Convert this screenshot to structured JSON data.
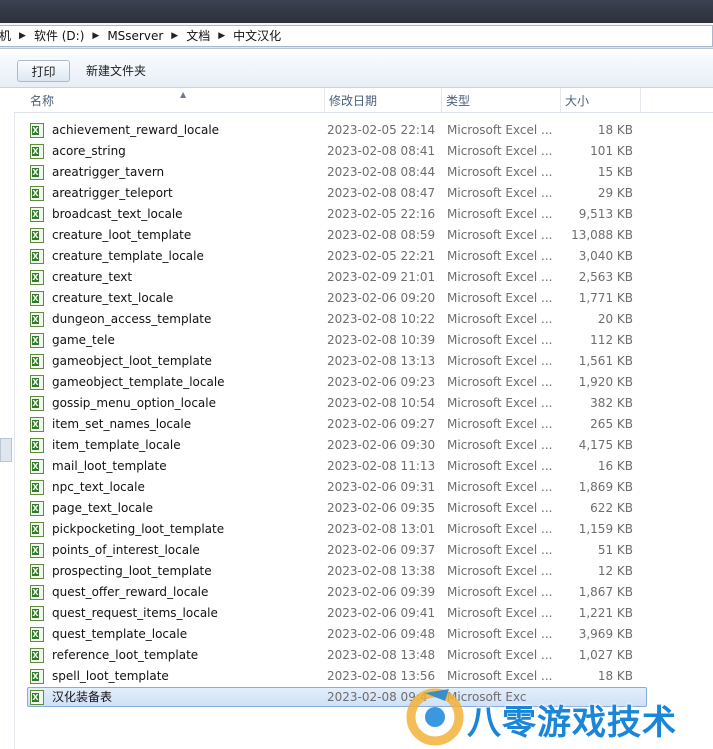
{
  "address": {
    "segments": [
      "机",
      "软件 (D:)",
      "MSserver",
      "文档",
      "中文汉化"
    ]
  },
  "toolbar": {
    "print_label": "打印",
    "new_folder_label": "新建文件夹"
  },
  "columns": {
    "name": "名称",
    "date": "修改日期",
    "type": "类型",
    "size": "大小"
  },
  "files": [
    {
      "name": "achievement_reward_locale",
      "date": "2023-02-05 22:14",
      "type": "Microsoft Excel ...",
      "size": "18 KB"
    },
    {
      "name": "acore_string",
      "date": "2023-02-08 08:41",
      "type": "Microsoft Excel ...",
      "size": "101 KB"
    },
    {
      "name": "areatrigger_tavern",
      "date": "2023-02-08 08:44",
      "type": "Microsoft Excel ...",
      "size": "15 KB"
    },
    {
      "name": "areatrigger_teleport",
      "date": "2023-02-08 08:47",
      "type": "Microsoft Excel ...",
      "size": "29 KB"
    },
    {
      "name": "broadcast_text_locale",
      "date": "2023-02-05 22:16",
      "type": "Microsoft Excel ...",
      "size": "9,513 KB"
    },
    {
      "name": "creature_loot_template",
      "date": "2023-02-08 08:59",
      "type": "Microsoft Excel ...",
      "size": "13,088 KB"
    },
    {
      "name": "creature_template_locale",
      "date": "2023-02-05 22:21",
      "type": "Microsoft Excel ...",
      "size": "3,040 KB"
    },
    {
      "name": "creature_text",
      "date": "2023-02-09 21:01",
      "type": "Microsoft Excel ...",
      "size": "2,563 KB"
    },
    {
      "name": "creature_text_locale",
      "date": "2023-02-06 09:20",
      "type": "Microsoft Excel ...",
      "size": "1,771 KB"
    },
    {
      "name": "dungeon_access_template",
      "date": "2023-02-08 10:22",
      "type": "Microsoft Excel ...",
      "size": "20 KB"
    },
    {
      "name": "game_tele",
      "date": "2023-02-08 10:39",
      "type": "Microsoft Excel ...",
      "size": "112 KB"
    },
    {
      "name": "gameobject_loot_template",
      "date": "2023-02-08 13:13",
      "type": "Microsoft Excel ...",
      "size": "1,561 KB"
    },
    {
      "name": "gameobject_template_locale",
      "date": "2023-02-06 09:23",
      "type": "Microsoft Excel ...",
      "size": "1,920 KB"
    },
    {
      "name": "gossip_menu_option_locale",
      "date": "2023-02-08 10:54",
      "type": "Microsoft Excel ...",
      "size": "382 KB"
    },
    {
      "name": "item_set_names_locale",
      "date": "2023-02-06 09:27",
      "type": "Microsoft Excel ...",
      "size": "265 KB"
    },
    {
      "name": "item_template_locale",
      "date": "2023-02-06 09:30",
      "type": "Microsoft Excel ...",
      "size": "4,175 KB"
    },
    {
      "name": "mail_loot_template",
      "date": "2023-02-08 11:13",
      "type": "Microsoft Excel ...",
      "size": "16 KB"
    },
    {
      "name": "npc_text_locale",
      "date": "2023-02-06 09:31",
      "type": "Microsoft Excel ...",
      "size": "1,869 KB"
    },
    {
      "name": "page_text_locale",
      "date": "2023-02-06 09:35",
      "type": "Microsoft Excel ...",
      "size": "622 KB"
    },
    {
      "name": "pickpocketing_loot_template",
      "date": "2023-02-08 13:01",
      "type": "Microsoft Excel ...",
      "size": "1,159 KB"
    },
    {
      "name": "points_of_interest_locale",
      "date": "2023-02-06 09:37",
      "type": "Microsoft Excel ...",
      "size": "51 KB"
    },
    {
      "name": "prospecting_loot_template",
      "date": "2023-02-08 13:38",
      "type": "Microsoft Excel ...",
      "size": "12 KB"
    },
    {
      "name": "quest_offer_reward_locale",
      "date": "2023-02-06 09:39",
      "type": "Microsoft Excel ...",
      "size": "1,867 KB"
    },
    {
      "name": "quest_request_items_locale",
      "date": "2023-02-06 09:41",
      "type": "Microsoft Excel ...",
      "size": "1,221 KB"
    },
    {
      "name": "quest_template_locale",
      "date": "2023-02-06 09:48",
      "type": "Microsoft Excel ...",
      "size": "3,969 KB"
    },
    {
      "name": "reference_loot_template",
      "date": "2023-02-08 13:48",
      "type": "Microsoft Excel ...",
      "size": "1,027 KB"
    },
    {
      "name": "spell_loot_template",
      "date": "2023-02-08 13:56",
      "type": "Microsoft Excel ...",
      "size": "18 KB"
    },
    {
      "name": "汉化装备表",
      "date": "2023-02-08 09:4",
      "type": "Microsoft Exc",
      "size": "",
      "selected": true
    }
  ],
  "watermark": {
    "text": "八零游戏技术"
  },
  "colors": {
    "title_bar": "#2f3440",
    "selection": "#cfe1f7",
    "header_text": "#4c607a",
    "watermark": "#1a86d8"
  },
  "icons": {
    "file": "excel-file-icon",
    "breadcrumb_separator": "chevron-right-icon",
    "sort": "sort-up-icon"
  }
}
